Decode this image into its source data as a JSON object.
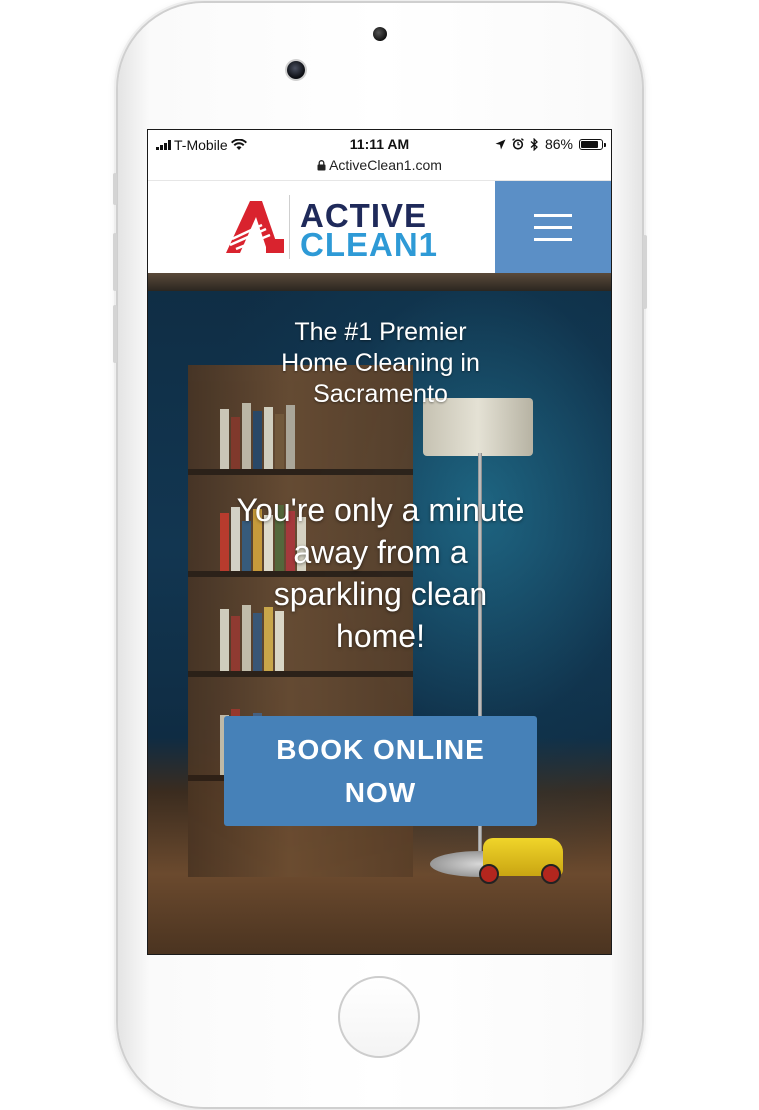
{
  "status_bar": {
    "carrier": "T-Mobile",
    "time": "11:11 AM",
    "battery": "86%",
    "battery_level": 0.86,
    "url": "ActiveClean1.com"
  },
  "header": {
    "logo_line1": "ACTIVE",
    "logo_line2": "CLEAN1"
  },
  "hero": {
    "subtitle": "The #1 Premier Home Cleaning in Sacramento",
    "title": "You're only a minute away from a sparkling clean home!",
    "cta_label": "BOOK ONLINE NOW"
  },
  "colors": {
    "brand_navy": "#1f2a5a",
    "brand_blue": "#2e9ad6",
    "logo_red": "#d9232e",
    "menu_bg": "#5b8fc6",
    "cta_bg": "#4681b8"
  },
  "icons": [
    "wifi-icon",
    "lock-icon",
    "location-arrow-icon",
    "alarm-icon",
    "bluetooth-icon",
    "battery-icon",
    "hamburger-menu-icon"
  ]
}
